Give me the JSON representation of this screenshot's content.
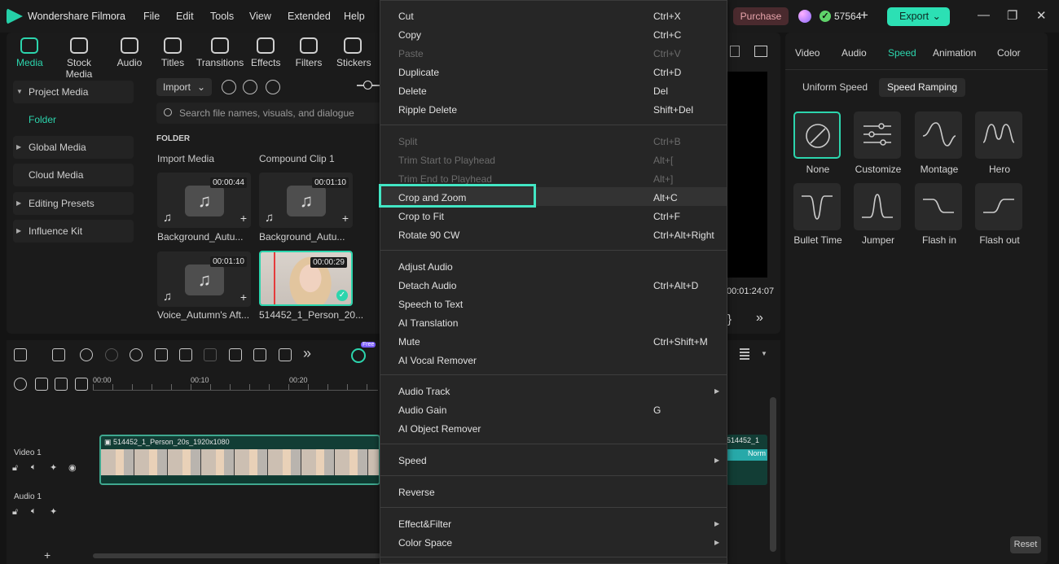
{
  "app": {
    "title": "Wondershare Filmora",
    "menus": [
      "File",
      "Edit",
      "Tools",
      "View",
      "Extended",
      "Help"
    ],
    "purchase": "Purchase",
    "credits": "57564",
    "export": "Export"
  },
  "toolbar": [
    "Media",
    "Stock Media",
    "Audio",
    "Titles",
    "Transitions",
    "Effects",
    "Filters",
    "Stickers"
  ],
  "nav": {
    "project_media": "Project Media",
    "folder": "Folder",
    "global_media": "Global Media",
    "cloud_media": "Cloud Media",
    "editing_presets": "Editing Presets",
    "influence_kit": "Influence Kit"
  },
  "media": {
    "import": "Import",
    "search_placeholder": "Search file names, visuals, and dialogue",
    "folder_label": "FOLDER",
    "col1": "Import Media",
    "col2": "Compound Clip 1",
    "items": [
      {
        "name": "Background_Autu...",
        "duration": "00:00:44"
      },
      {
        "name": "Background_Autu...",
        "duration": "00:01:10"
      },
      {
        "name": "Voice_Autumn's Aft...",
        "duration": "00:01:10"
      },
      {
        "name": "514452_1_Person_20...",
        "duration": "00:00:29"
      }
    ]
  },
  "preview": {
    "timecode": "00:01:24:07"
  },
  "timeline": {
    "ticks": [
      "00:00",
      "00:10",
      "00:20"
    ],
    "video_track": "Video 1",
    "audio_track": "Audio 1",
    "clip_label": "514452_1_Person_20s_1920x1080",
    "clip2_label": "514452_1",
    "normal": "Norm",
    "free": "Free"
  },
  "context_menu": [
    {
      "label": "Cut",
      "shortcut": "Ctrl+X",
      "enabled": true
    },
    {
      "label": "Copy",
      "shortcut": "Ctrl+C",
      "enabled": true
    },
    {
      "label": "Paste",
      "shortcut": "Ctrl+V",
      "enabled": false
    },
    {
      "label": "Duplicate",
      "shortcut": "Ctrl+D",
      "enabled": true
    },
    {
      "label": "Delete",
      "shortcut": "Del",
      "enabled": true
    },
    {
      "label": "Ripple Delete",
      "shortcut": "Shift+Del",
      "enabled": true
    },
    {
      "label": "Split",
      "shortcut": "Ctrl+B",
      "enabled": false
    },
    {
      "label": "Trim Start to Playhead",
      "shortcut": "Alt+[",
      "enabled": false
    },
    {
      "label": "Trim End to Playhead",
      "shortcut": "Alt+]",
      "enabled": false
    },
    {
      "label": "Crop and Zoom",
      "shortcut": "Alt+C",
      "enabled": true
    },
    {
      "label": "Crop to Fit",
      "shortcut": "Ctrl+F",
      "enabled": true
    },
    {
      "label": "Rotate 90 CW",
      "shortcut": "Ctrl+Alt+Right",
      "enabled": true
    },
    {
      "label": "Adjust Audio",
      "shortcut": "",
      "enabled": true
    },
    {
      "label": "Detach Audio",
      "shortcut": "Ctrl+Alt+D",
      "enabled": true
    },
    {
      "label": "Speech to Text",
      "shortcut": "",
      "enabled": true
    },
    {
      "label": "AI Translation",
      "shortcut": "",
      "enabled": true
    },
    {
      "label": "Mute",
      "shortcut": "Ctrl+Shift+M",
      "enabled": true
    },
    {
      "label": "AI Vocal Remover",
      "shortcut": "",
      "enabled": true
    },
    {
      "label": "Audio Track",
      "shortcut": "",
      "enabled": true
    },
    {
      "label": "Audio Gain",
      "shortcut": "G",
      "enabled": true
    },
    {
      "label": "AI Object Remover",
      "shortcut": "",
      "enabled": true
    },
    {
      "label": "Speed",
      "shortcut": "",
      "enabled": true
    },
    {
      "label": "Reverse",
      "shortcut": "",
      "enabled": true
    },
    {
      "label": "Effect&Filter",
      "shortcut": "",
      "enabled": true
    },
    {
      "label": "Color Space",
      "shortcut": "",
      "enabled": true
    }
  ],
  "right": {
    "tabs": [
      "Video",
      "Audio",
      "Speed",
      "Animation",
      "Color"
    ],
    "subtabs": [
      "Uniform Speed",
      "Speed Ramping"
    ],
    "presets": [
      "None",
      "Customize",
      "Montage",
      "Hero",
      "Bullet Time",
      "Jumper",
      "Flash in",
      "Flash out"
    ],
    "reset": "Reset"
  },
  "colors": {
    "accent": "#2cd5ad",
    "highlight_box": "#42e6c4"
  }
}
